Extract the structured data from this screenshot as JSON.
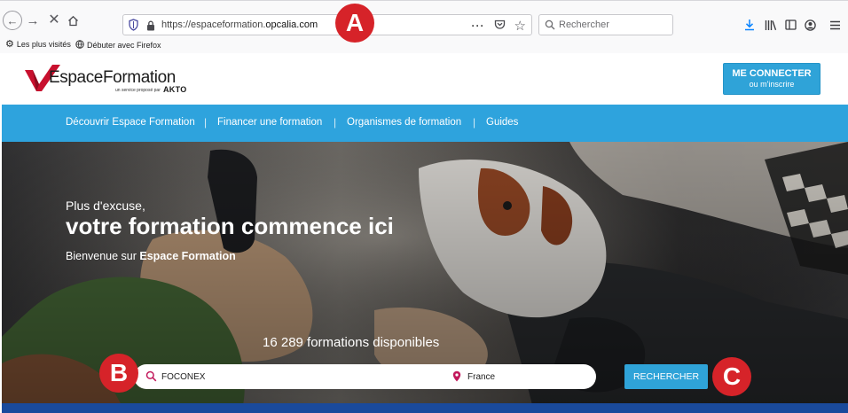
{
  "browser": {
    "url_prefix": "https://espaceformation.",
    "url_domain": "opcalia.com",
    "search_placeholder": "Rechercher",
    "bookmarks": [
      "Les plus visités",
      "Débuter avec Firefox"
    ]
  },
  "site": {
    "logo_name": "EspaceFormation",
    "logo_subtitle": "un service proposé par",
    "logo_brand": "AKTO",
    "connect_line1": "ME CONNECTER",
    "connect_line2": "ou m'inscrire"
  },
  "nav": {
    "items": [
      "Découvrir Espace Formation",
      "Financer une formation",
      "Organismes de formation",
      "Guides"
    ],
    "separator": "|"
  },
  "hero": {
    "tagline": "Plus d'excuse,",
    "title": "votre formation commence ici",
    "welcome_prefix": "Bienvenue sur ",
    "welcome_brand": "Espace Formation",
    "count_text": "16 289 formations disponibles",
    "search_value": "FOCONEX",
    "location_value": "France",
    "search_button": "RECHERCHER"
  },
  "annotations": [
    "A",
    "B",
    "C"
  ],
  "colors": {
    "accent_blue": "#2ea3dd",
    "logo_red": "#c8102e",
    "badge_red": "#d62329",
    "pin_magenta": "#c2185b"
  },
  "icons": [
    "back-arrow-icon",
    "forward-arrow-icon",
    "stop-icon",
    "home-icon",
    "tracking-shield-icon",
    "lock-icon",
    "page-actions-icon",
    "pocket-icon",
    "bookmark-star-icon",
    "search-icon",
    "download-icon",
    "library-icon",
    "sidebar-icon",
    "account-icon",
    "menu-icon",
    "gear-icon",
    "globe-icon",
    "location-pin-icon"
  ]
}
